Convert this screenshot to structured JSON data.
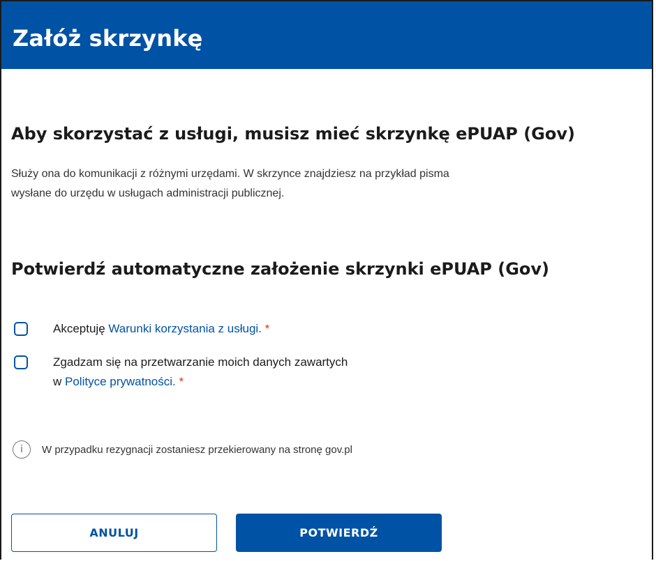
{
  "header": {
    "title": "Załóż skrzynkę"
  },
  "intro": {
    "title": "Aby skorzystać z usługi, musisz mieć skrzynkę ePUAP (Gov)",
    "description_line1": "Służy ona do komunikacji z różnymi urzędami. W skrzynce znajdziesz na przykład pisma",
    "description_line2": "wysłane do urzędu w usługach administracji publicznej."
  },
  "confirm_section": {
    "title": "Potwierdź automatyczne założenie skrzynki ePUAP (Gov)",
    "terms": {
      "prefix": "Akceptuję ",
      "link": "Warunki korzystania z usługi.",
      "required_mark": " *",
      "checked": false
    },
    "privacy": {
      "line1": "Zgadzam się na przetwarzanie moich danych zawartych",
      "prefix": "w ",
      "link": "Polityce prywatności.",
      "required_mark": " *",
      "checked": false
    }
  },
  "info": {
    "icon": "info-icon",
    "glyph": "i",
    "text": "W przypadku rezygnacji zostaniesz przekierowany na stronę gov.pl"
  },
  "buttons": {
    "cancel": "ANULUJ",
    "confirm": "POTWIERDŹ"
  },
  "colors": {
    "brand": "#0052a5",
    "required": "#d4351c"
  }
}
